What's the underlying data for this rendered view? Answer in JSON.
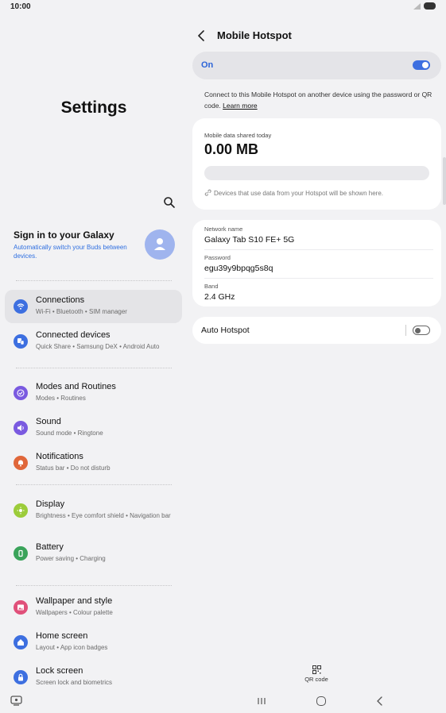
{
  "status_bar": {
    "time": "10:00"
  },
  "left_pane": {
    "title": "Settings",
    "account": {
      "title": "Sign in to your Galaxy",
      "subtitle": "Automatically switch your Buds between devices."
    },
    "groups": [
      [
        {
          "title": "Connections",
          "subtitle": "Wi-Fi  •  Bluetooth  •  SIM manager",
          "icon": "wifi-icon",
          "color": "#3d6fe0",
          "active": true
        },
        {
          "title": "Connected devices",
          "subtitle": "Quick Share  •  Samsung DeX  •  Android Auto",
          "icon": "devices-icon",
          "color": "#3d6fe0"
        }
      ],
      [
        {
          "title": "Modes and Routines",
          "subtitle": "Modes  •  Routines",
          "icon": "check-circle-icon",
          "color": "#7a5ae0"
        },
        {
          "title": "Sound",
          "subtitle": "Sound mode  •  Ringtone",
          "icon": "speaker-icon",
          "color": "#7a5ae0"
        },
        {
          "title": "Notifications",
          "subtitle": "Status bar  •  Do not disturb",
          "icon": "bell-icon",
          "color": "#e0673a"
        }
      ],
      [
        {
          "title": "Display",
          "subtitle": "Brightness  •  Eye comfort shield  •  Navigation bar",
          "icon": "sun-icon",
          "color": "#9ccc3a"
        },
        {
          "title": "Battery",
          "subtitle": "Power saving  •  Charging",
          "icon": "battery-icon",
          "color": "#3aa35a"
        }
      ],
      [
        {
          "title": "Wallpaper and style",
          "subtitle": "Wallpapers  •  Colour palette",
          "icon": "image-icon",
          "color": "#e0507a"
        },
        {
          "title": "Home screen",
          "subtitle": "Layout  •  App icon badges",
          "icon": "home-icon",
          "color": "#3d6fe0"
        },
        {
          "title": "Lock screen",
          "subtitle": "Screen lock and biometrics",
          "icon": "lock-icon",
          "color": "#3d6fe0"
        }
      ]
    ]
  },
  "detail": {
    "title": "Mobile Hotspot",
    "master_switch": {
      "label": "On",
      "enabled": true
    },
    "description": "Connect to this Mobile Hotspot on another device using the password or QR code.",
    "learn_more": "Learn more",
    "data_usage": {
      "label": "Mobile data shared today",
      "value": "0.00 MB",
      "note": "Devices that use data from your Hotspot will be shown here."
    },
    "network": {
      "name_label": "Network name",
      "name_value": "Galaxy Tab S10 FE+ 5G",
      "password_label": "Password",
      "password_value": "egu39y9bpqg5s8q",
      "band_label": "Band",
      "band_value": "2.4 GHz"
    },
    "auto_hotspot": {
      "label": "Auto Hotspot",
      "enabled": false
    },
    "qr_code_label": "QR code"
  },
  "colors": {
    "accent": "#3d6fe0",
    "background": "#f2f2f4"
  }
}
